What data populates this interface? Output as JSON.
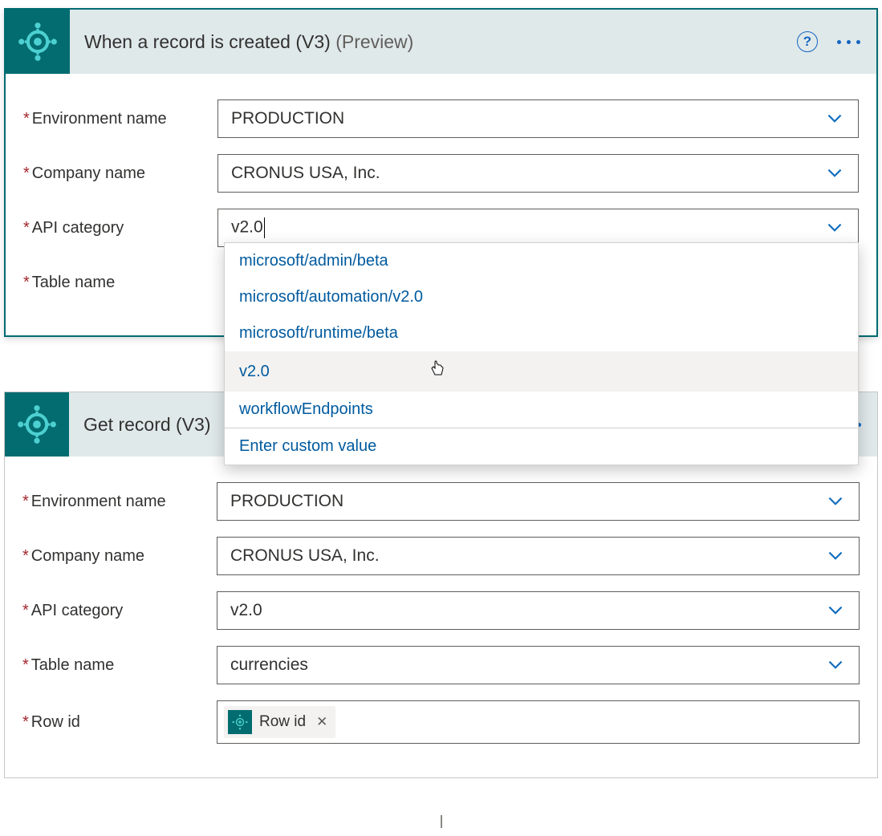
{
  "cards": [
    {
      "title": "When a record is created (V3)",
      "preview": "(Preview)",
      "fields": {
        "env_label": "Environment name",
        "env_value": "PRODUCTION",
        "company_label": "Company name",
        "company_value": "CRONUS USA, Inc.",
        "api_label": "API category",
        "api_value": "v2.0",
        "table_label": "Table name"
      },
      "dropdown_options": [
        "microsoft/admin/beta",
        "microsoft/automation/v2.0",
        "microsoft/runtime/beta",
        "v2.0",
        "workflowEndpoints"
      ],
      "dropdown_footer": "Enter custom value"
    },
    {
      "title": "Get record (V3)",
      "fields": {
        "env_label": "Environment name",
        "env_value": "PRODUCTION",
        "company_label": "Company name",
        "company_value": "CRONUS USA, Inc.",
        "api_label": "API category",
        "api_value": "v2.0",
        "table_label": "Table name",
        "table_value": "currencies",
        "rowid_label": "Row id",
        "rowid_token": "Row id"
      }
    }
  ]
}
